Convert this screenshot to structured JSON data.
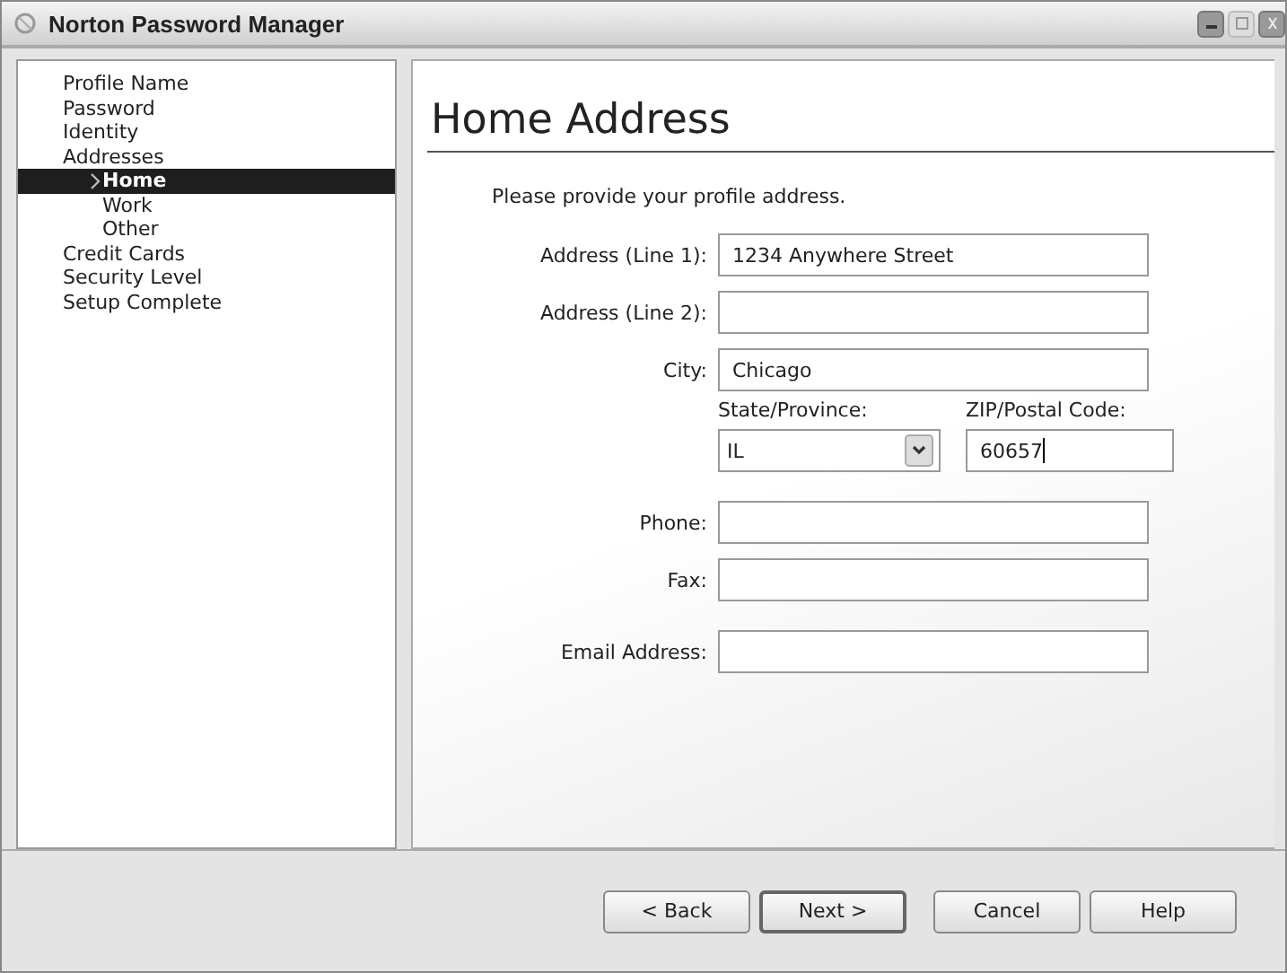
{
  "window": {
    "title": "Norton Password Manager"
  },
  "sidebar": {
    "items": [
      {
        "label": "Profile Name",
        "selected": false
      },
      {
        "label": "Password",
        "selected": false
      },
      {
        "label": "Identity",
        "selected": false
      },
      {
        "label": "Addresses",
        "selected": false,
        "children": [
          {
            "label": "Home",
            "selected": true
          },
          {
            "label": "Work",
            "selected": false
          },
          {
            "label": "Other",
            "selected": false
          }
        ]
      },
      {
        "label": "Credit Cards",
        "selected": false
      },
      {
        "label": "Security Level",
        "selected": false
      },
      {
        "label": "Setup Complete",
        "selected": false
      }
    ]
  },
  "page": {
    "heading": "Home Address",
    "instruction": "Please provide your profile address.",
    "address_fields": [
      {
        "label": "Address (Line 1):",
        "value": "1234 Anywhere Street"
      },
      {
        "label": "Address (Line 2):"
      },
      {
        "label": "City:",
        "value": "Chicago"
      }
    ],
    "region": {
      "state": {
        "label": "State/Province:",
        "value": "IL"
      },
      "zip": {
        "label": "ZIP/Postal Code:",
        "value": "60657",
        "focused": true
      }
    },
    "contact_fields": [
      {
        "label": "Phone:"
      },
      {
        "label": "Fax:"
      }
    ],
    "email_field": {
      "label": "Email Address:"
    }
  },
  "buttons": [
    {
      "label": "< Back",
      "default": false
    },
    {
      "label": "Next >",
      "default": true
    },
    {
      "label": "Cancel",
      "default": false
    },
    {
      "label": "Help",
      "default": false
    }
  ]
}
